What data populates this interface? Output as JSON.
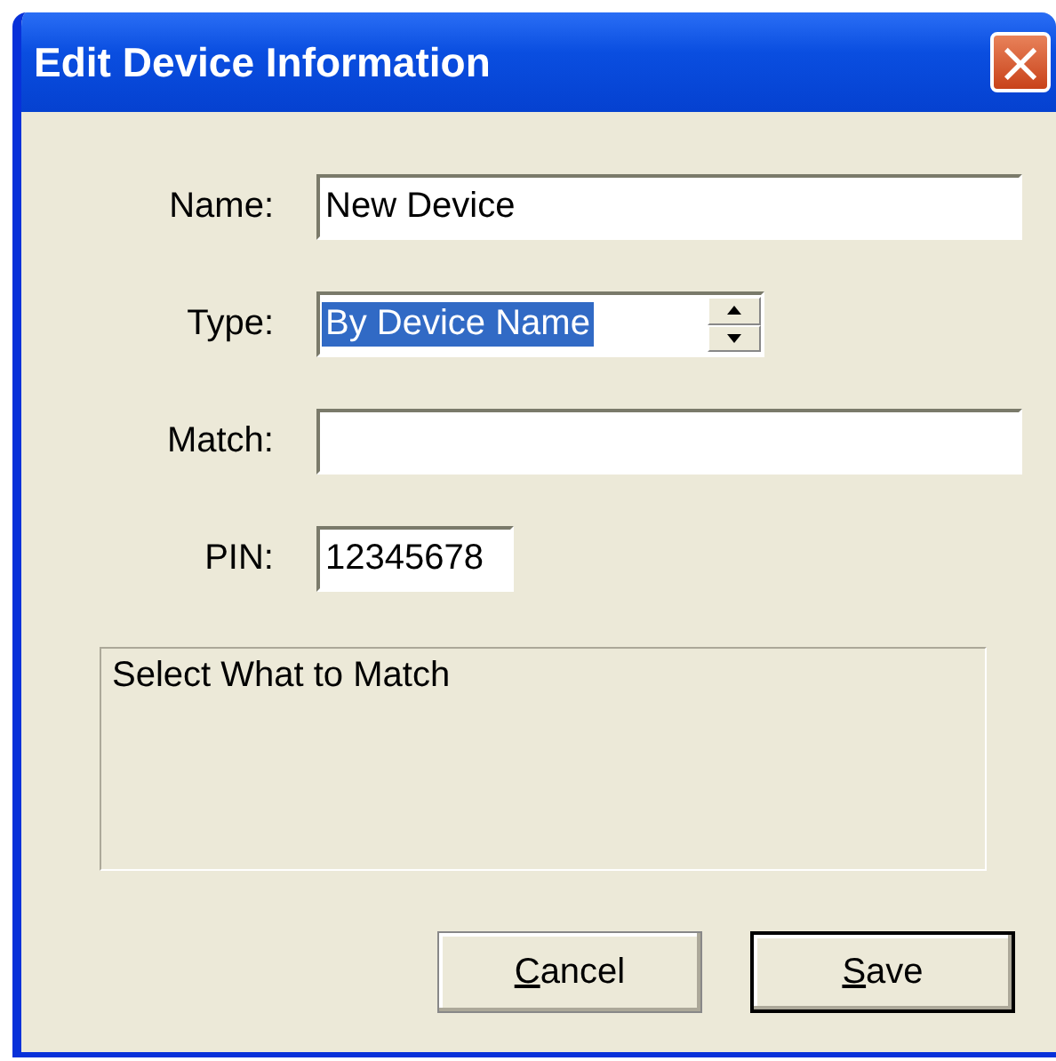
{
  "window": {
    "title": "Edit Device Information",
    "close": "×"
  },
  "fields": [
    {
      "label": "Name:",
      "kind": "text",
      "value": "New Device"
    },
    {
      "label": "Type:",
      "kind": "spinner",
      "value": "By Device Name",
      "selected": true
    },
    {
      "label": "Match:",
      "kind": "text"
    },
    {
      "label": "PIN:",
      "kind": "text",
      "value": "12345678"
    }
  ],
  "info_box": {
    "text": "Select What to Match"
  },
  "buttons": [
    {
      "accel": "C",
      "rest": "ancel",
      "default": false
    },
    {
      "accel": "S",
      "rest": "ave",
      "default": true
    }
  ]
}
